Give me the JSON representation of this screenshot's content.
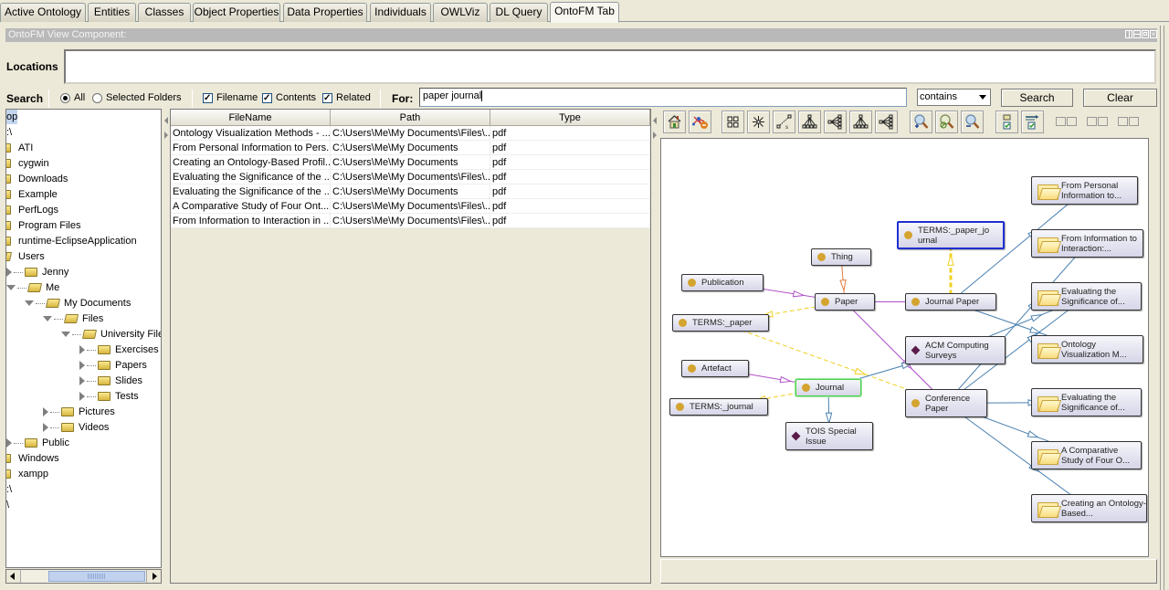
{
  "tabs": [
    {
      "label": "Active Ontology",
      "active": false
    },
    {
      "label": "Entities",
      "active": false
    },
    {
      "label": "Classes",
      "active": false
    },
    {
      "label": "Object Properties",
      "active": false
    },
    {
      "label": "Data Properties",
      "active": false
    },
    {
      "label": "Individuals",
      "active": false
    },
    {
      "label": "OWLViz",
      "active": false
    },
    {
      "label": "DL Query",
      "active": false
    },
    {
      "label": "OntoFM Tab",
      "active": true
    }
  ],
  "view": {
    "title": "OntoFM View Component:",
    "window_buttons": [
      "split-icon",
      "minimize-icon",
      "maximize-icon",
      "close-icon"
    ]
  },
  "locations": {
    "label": "Locations",
    "value": ""
  },
  "search": {
    "label": "Search",
    "scope": {
      "all": "All",
      "selected": "Selected Folders",
      "selected_value": "All"
    },
    "filters": [
      {
        "label": "Filename",
        "checked": true
      },
      {
        "label": "Contents",
        "checked": true
      },
      {
        "label": "Related",
        "checked": true
      }
    ],
    "for_label": "For:",
    "query": "paper journal",
    "match_mode": "contains",
    "search_button": "Search",
    "clear_button": "Clear"
  },
  "tree": {
    "items": [
      {
        "label": "op",
        "level": 0,
        "icon": "none",
        "expander": "none",
        "selected": true
      },
      {
        "label": ":\\",
        "level": 0,
        "icon": "none",
        "expander": "none"
      },
      {
        "label": "ATI",
        "level": 0,
        "icon": "folder",
        "expander": "none"
      },
      {
        "label": "cygwin",
        "level": 0,
        "icon": "folder",
        "expander": "none"
      },
      {
        "label": "Downloads",
        "level": 0,
        "icon": "folder",
        "expander": "none"
      },
      {
        "label": "Example",
        "level": 0,
        "icon": "folder",
        "expander": "none"
      },
      {
        "label": "PerfLogs",
        "level": 0,
        "icon": "folder",
        "expander": "none"
      },
      {
        "label": "Program Files",
        "level": 0,
        "icon": "folder",
        "expander": "none"
      },
      {
        "label": "runtime-EclipseApplication",
        "level": 0,
        "icon": "folder",
        "expander": "none"
      },
      {
        "label": "Users",
        "level": 0,
        "icon": "folder-open",
        "expander": "none"
      },
      {
        "label": "Jenny",
        "level": 1,
        "icon": "folder",
        "expander": "collapsed"
      },
      {
        "label": "Me",
        "level": 1,
        "icon": "folder-open",
        "expander": "expanded"
      },
      {
        "label": "My Documents",
        "level": 2,
        "icon": "folder-open",
        "expander": "expanded"
      },
      {
        "label": "Files",
        "level": 3,
        "icon": "folder-open",
        "expander": "expanded"
      },
      {
        "label": "University Files",
        "level": 4,
        "icon": "folder-open",
        "expander": "expanded"
      },
      {
        "label": "Exercises",
        "level": 5,
        "icon": "folder",
        "expander": "collapsed"
      },
      {
        "label": "Papers",
        "level": 5,
        "icon": "folder",
        "expander": "collapsed"
      },
      {
        "label": "Slides",
        "level": 5,
        "icon": "folder",
        "expander": "collapsed"
      },
      {
        "label": "Tests",
        "level": 5,
        "icon": "folder",
        "expander": "collapsed"
      },
      {
        "label": "Pictures",
        "level": 3,
        "icon": "folder",
        "expander": "collapsed"
      },
      {
        "label": "Videos",
        "level": 3,
        "icon": "folder",
        "expander": "collapsed"
      },
      {
        "label": "Public",
        "level": 1,
        "icon": "folder",
        "expander": "collapsed"
      },
      {
        "label": "Windows",
        "level": 0,
        "icon": "folder",
        "expander": "none"
      },
      {
        "label": "xampp",
        "level": 0,
        "icon": "folder",
        "expander": "none"
      },
      {
        "label": ":\\",
        "level": 0,
        "icon": "none",
        "expander": "none"
      },
      {
        "label": "\\",
        "level": 0,
        "icon": "none",
        "expander": "none"
      }
    ]
  },
  "results": {
    "columns": [
      "FileName",
      "Path",
      "Type"
    ],
    "rows": [
      [
        "Ontology Visualization Methods - ...",
        "C:\\Users\\Me\\My Documents\\Files\\...",
        "pdf"
      ],
      [
        "From Personal Information to Pers...",
        "C:\\Users\\Me\\My Documents",
        "pdf"
      ],
      [
        "Creating an Ontology-Based Profil...",
        "C:\\Users\\Me\\My Documents",
        "pdf"
      ],
      [
        "Evaluating the Significance of the ...",
        "C:\\Users\\Me\\My Documents\\Files\\...",
        "pdf"
      ],
      [
        "Evaluating the Significance of the ...",
        "C:\\Users\\Me\\My Documents",
        "pdf"
      ],
      [
        "A Comparative Study of Four Ont...",
        "C:\\Users\\Me\\My Documents\\Files\\...",
        "pdf"
      ],
      [
        "From Information to Interaction in ...",
        "C:\\Users\\Me\\My Documents\\Files\\...",
        "pdf"
      ]
    ]
  },
  "graph_toolbar": {
    "buttons": [
      "home-icon",
      "remove-edges-icon",
      "grid-layout-icon",
      "radial-layout-icon",
      "spring-layout-icon",
      "tree-layout-icon",
      "horizontal-tree-layout-icon",
      "tree-layout-2-icon",
      "horizontal-tree-layout-2-icon",
      "zoom-in-icon",
      "zoom-reset-icon",
      "zoom-out-icon",
      "select-checked-icon",
      "select-related-icon"
    ]
  },
  "graph": {
    "colors": {
      "subclass_edge": "#b050c8",
      "thing_edge": "#e07a3a",
      "terms_edge": "#f0d020",
      "file_edge": "#4a80b0",
      "class_dot": "#d4a430",
      "individual": "#5a1a4a",
      "selected_blue": "#1f2fd0",
      "selected_green": "#4cd04c"
    },
    "nodes": [
      {
        "id": "thing",
        "label": "Thing",
        "kind": "class"
      },
      {
        "id": "publication",
        "label": "Publication",
        "kind": "class"
      },
      {
        "id": "paper",
        "label": "Paper",
        "kind": "class"
      },
      {
        "id": "terms_paper",
        "label": "TERMS:_paper",
        "kind": "class"
      },
      {
        "id": "terms_paper_journal",
        "label": "TERMS:_paper_jo urnal",
        "kind": "class",
        "selected": "blue"
      },
      {
        "id": "journal_paper",
        "label": "Journal Paper",
        "kind": "class"
      },
      {
        "id": "acm",
        "label": "ACM Computing Surveys",
        "kind": "individual"
      },
      {
        "id": "conference_paper",
        "label": "Conference Paper",
        "kind": "class"
      },
      {
        "id": "artefact",
        "label": "Artefact",
        "kind": "class"
      },
      {
        "id": "journal",
        "label": "Journal",
        "kind": "class",
        "selected": "green"
      },
      {
        "id": "terms_journal",
        "label": "TERMS:_journal",
        "kind": "class"
      },
      {
        "id": "tois",
        "label": "TOIS Special Issue",
        "kind": "individual"
      },
      {
        "id": "f1",
        "label": "From Personal Information to...",
        "kind": "file"
      },
      {
        "id": "f2",
        "label": "From Information to Interaction:...",
        "kind": "file"
      },
      {
        "id": "f3",
        "label": "Evaluating the Significance of...",
        "kind": "file"
      },
      {
        "id": "f4",
        "label": "Ontology Visualization M...",
        "kind": "file"
      },
      {
        "id": "f5",
        "label": "Evaluating the Significance of...",
        "kind": "file"
      },
      {
        "id": "f6",
        "label": "A Comparative Study of Four O...",
        "kind": "file"
      },
      {
        "id": "f7",
        "label": "Creating an Ontology-Based...",
        "kind": "file"
      }
    ],
    "edges": [
      {
        "from": "publication",
        "to": "paper",
        "type": "subclass_edge"
      },
      {
        "from": "thing",
        "to": "paper",
        "type": "thing_edge"
      },
      {
        "from": "paper",
        "to": "terms_paper",
        "type": "terms_edge"
      },
      {
        "from": "paper",
        "to": "journal_paper",
        "type": "subclass_edge"
      },
      {
        "from": "paper",
        "to": "conference_paper",
        "type": "subclass_edge"
      },
      {
        "from": "journal_paper",
        "to": "terms_paper_journal",
        "type": "terms_edge"
      },
      {
        "from": "terms_paper",
        "to": "conference_paper",
        "type": "terms_edge"
      },
      {
        "from": "artefact",
        "to": "journal",
        "type": "subclass_edge"
      },
      {
        "from": "journal",
        "to": "terms_journal",
        "type": "terms_edge"
      },
      {
        "from": "journal",
        "to": "tois",
        "type": "file_edge"
      },
      {
        "from": "journal",
        "to": "acm",
        "type": "file_edge"
      },
      {
        "from": "journal_paper",
        "to": "f1",
        "type": "file_edge"
      },
      {
        "from": "journal_paper",
        "to": "f4",
        "type": "file_edge"
      },
      {
        "from": "acm",
        "to": "f3",
        "type": "file_edge"
      },
      {
        "from": "conference_paper",
        "to": "f2",
        "type": "file_edge"
      },
      {
        "from": "conference_paper",
        "to": "f5",
        "type": "file_edge"
      },
      {
        "from": "conference_paper",
        "to": "f6",
        "type": "file_edge"
      },
      {
        "from": "conference_paper",
        "to": "f7",
        "type": "file_edge"
      },
      {
        "from": "conference_paper",
        "to": "f3",
        "type": "file_edge"
      }
    ]
  }
}
